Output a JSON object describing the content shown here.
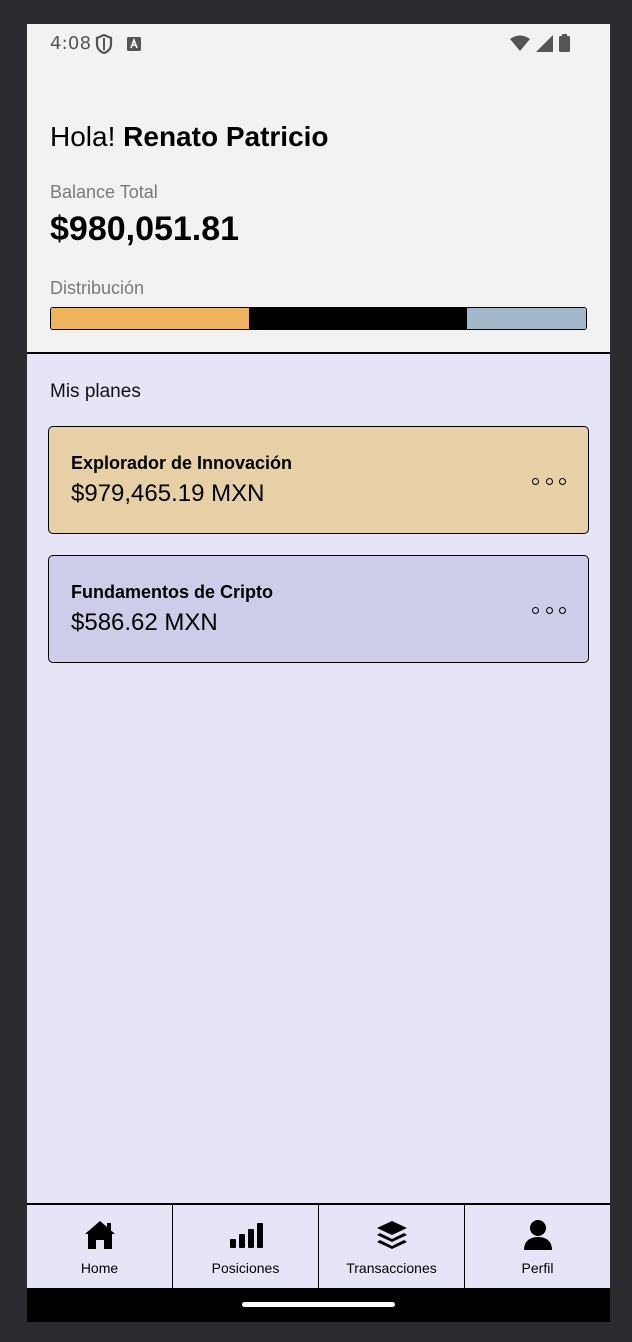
{
  "status_bar": {
    "time": "4:08"
  },
  "header": {
    "greeting_prefix": "Hola! ",
    "user_name": "Renato Patricio",
    "balance_label": "Balance Total",
    "balance_value": "$980,051.81",
    "distribution_label": "Distribución",
    "distribution_fractions": [
      0.371,
      0.407,
      0.222
    ],
    "distribution_colors": [
      "#edb35d",
      "#000000",
      "#a3b8c8"
    ]
  },
  "plans": {
    "title": "Mis planes",
    "items": [
      {
        "name": "Explorador de Innovación",
        "amount": "$979,465.19 MXN",
        "color": "#e7d0a6"
      },
      {
        "name": "Fundamentos de Cripto",
        "amount": "$586.62 MXN",
        "color": "#cdcce9"
      }
    ]
  },
  "nav": {
    "items": [
      {
        "label": "Home",
        "icon": "home-icon"
      },
      {
        "label": "Posiciones",
        "icon": "bar-chart-icon"
      },
      {
        "label": "Transacciones",
        "icon": "layers-icon"
      },
      {
        "label": "Perfil",
        "icon": "user-icon"
      }
    ]
  }
}
